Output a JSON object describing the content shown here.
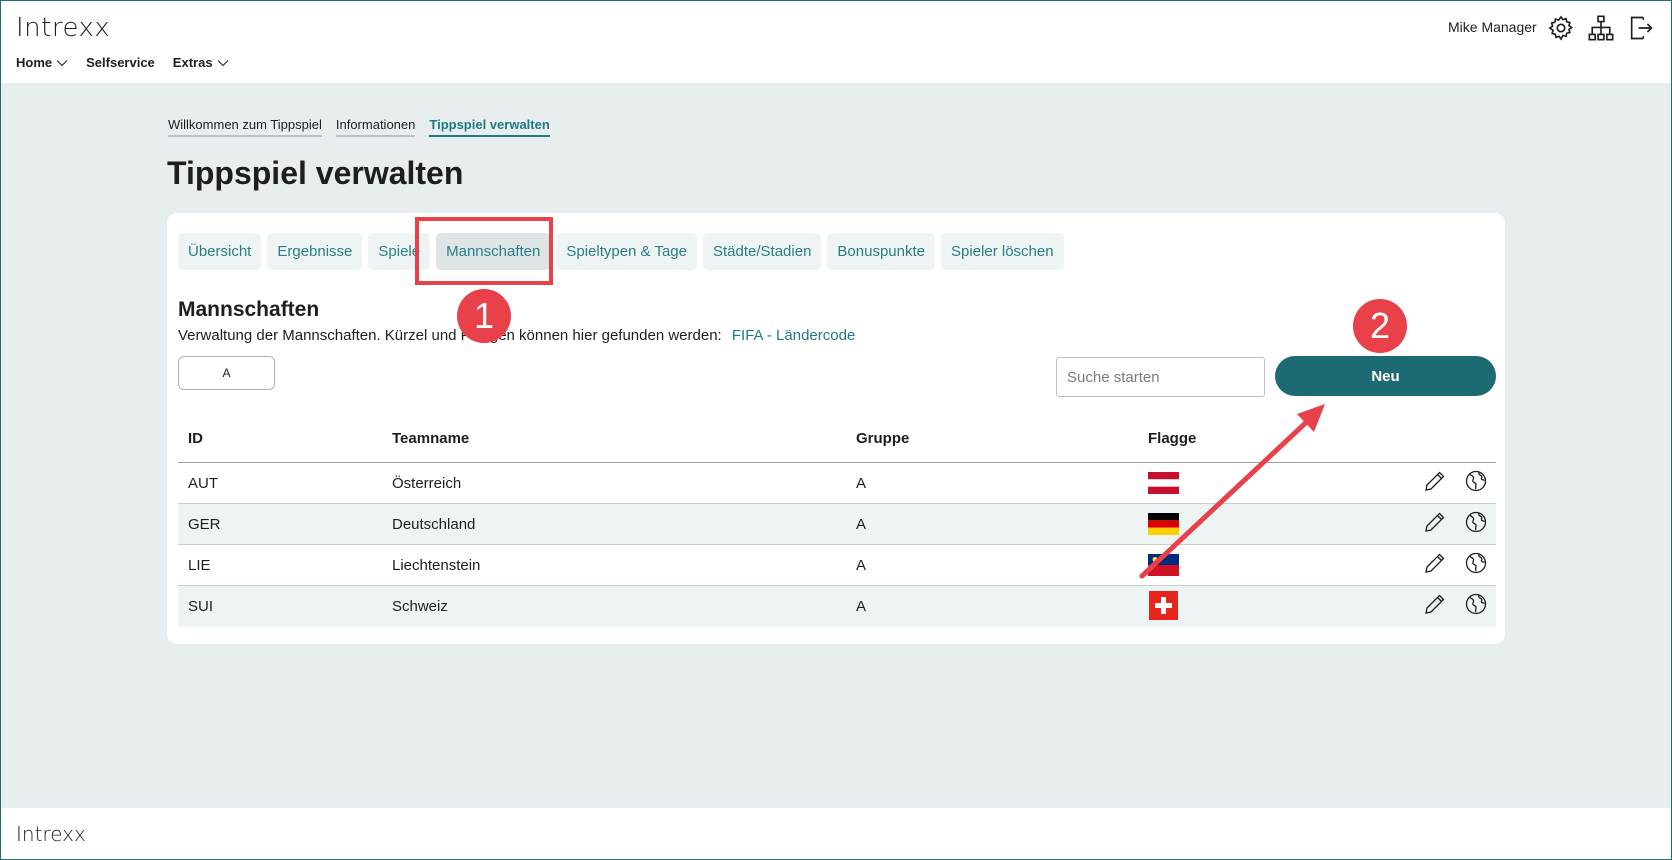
{
  "header": {
    "logo": "Intrexx",
    "user_name": "Mike Manager",
    "icons": [
      "gear-icon",
      "sitemap-icon",
      "logout-icon"
    ]
  },
  "nav": {
    "items": [
      {
        "label": "Home",
        "has_dropdown": true
      },
      {
        "label": "Selfservice",
        "has_dropdown": false
      },
      {
        "label": "Extras",
        "has_dropdown": true
      }
    ]
  },
  "breadcrumbs": [
    {
      "label": "Willkommen zum Tippspiel"
    },
    {
      "label": "Informationen"
    },
    {
      "label": "Tippspiel verwalten",
      "active": true
    }
  ],
  "page_title": "Tippspiel verwalten",
  "tabs": [
    {
      "label": "Übersicht"
    },
    {
      "label": "Ergebnisse"
    },
    {
      "label": "Spiele"
    },
    {
      "label": "Mannschaften",
      "selected": true
    },
    {
      "label": "Spieltypen & Tage"
    },
    {
      "label": "Städte/Stadien"
    },
    {
      "label": "Bonuspunkte"
    },
    {
      "label": "Spieler löschen"
    }
  ],
  "section": {
    "title": "Mannschaften",
    "description": "Verwaltung der Mannschaften. Kürzel und Flaggen können hier gefunden werden:",
    "link_label": "FIFA - Ländercode"
  },
  "filter": {
    "label": "A"
  },
  "search": {
    "placeholder": "Suche starten",
    "value": ""
  },
  "new_button": {
    "label": "Neu"
  },
  "table": {
    "columns": [
      "ID",
      "Teamname",
      "Gruppe",
      "Flagge"
    ],
    "rows": [
      {
        "id": "AUT",
        "name": "Österreich",
        "group": "A",
        "flag": "austria"
      },
      {
        "id": "GER",
        "name": "Deutschland",
        "group": "A",
        "flag": "germany"
      },
      {
        "id": "LIE",
        "name": "Liechtenstein",
        "group": "A",
        "flag": "liechtenstein"
      },
      {
        "id": "SUI",
        "name": "Schweiz",
        "group": "A",
        "flag": "switzerland"
      }
    ],
    "row_actions": [
      "pencil-icon",
      "globe-icon"
    ]
  },
  "annotations": {
    "badge_1": "1",
    "badge_2": "2",
    "color": "#e8414a"
  },
  "footer": {
    "logo": "Intrexx"
  },
  "colors": {
    "accent": "#1d6b72",
    "link": "#1f7a80",
    "background": "#e8eef0"
  }
}
